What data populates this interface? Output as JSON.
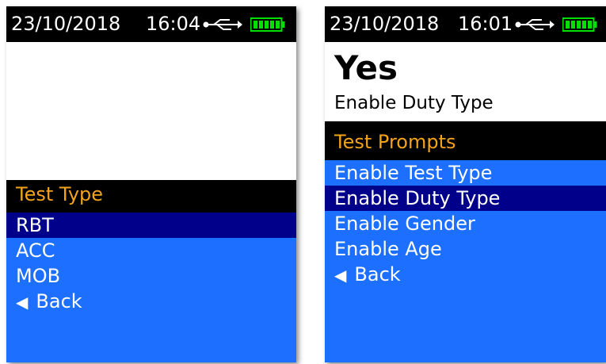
{
  "screens": [
    {
      "status": {
        "date": "23/10/2018",
        "time": "16:04",
        "usb_icon": "usb-icon",
        "battery_icon": "battery-full-icon"
      },
      "menu": {
        "title": "Test Type",
        "items": [
          {
            "label": "RBT",
            "selected": true
          },
          {
            "label": "ACC",
            "selected": false
          },
          {
            "label": "MOB",
            "selected": false
          }
        ],
        "back_label": "Back"
      }
    },
    {
      "status": {
        "date": "23/10/2018",
        "time": "16:01",
        "usb_icon": "usb-icon",
        "battery_icon": "battery-full-icon"
      },
      "display": {
        "value": "Yes",
        "caption": "Enable Duty Type"
      },
      "menu": {
        "title": "Test Prompts",
        "items": [
          {
            "label": "Enable Test Type",
            "selected": false
          },
          {
            "label": "Enable Duty Type",
            "selected": true
          },
          {
            "label": "Enable Gender",
            "selected": false
          },
          {
            "label": "Enable Age",
            "selected": false
          }
        ],
        "back_label": "Back"
      }
    }
  ],
  "colors": {
    "background": "#000000",
    "menu_blue": "#1c6fff",
    "selected_navy": "#00008b",
    "title_orange": "#f2a31a",
    "battery_green": "#00e000"
  }
}
